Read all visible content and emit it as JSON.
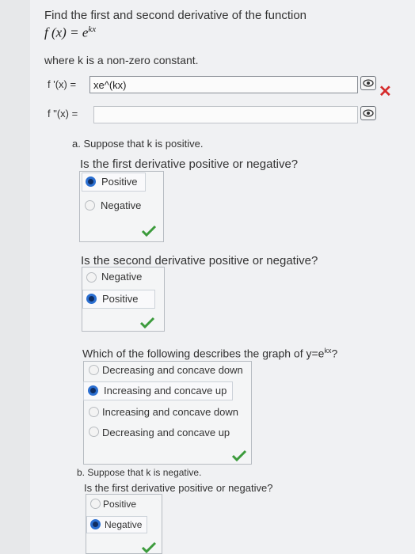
{
  "header": {
    "title": "Find the first and second derivative of the function",
    "function_lhs": "f (x) = e",
    "function_exp": "kx",
    "where": "where k is a non-zero constant."
  },
  "answers": {
    "first": {
      "label": "f '(x) =",
      "value": "xe^(kx)",
      "status": "incorrect"
    },
    "second": {
      "label": "f \"(x) =",
      "value": ""
    }
  },
  "part_a": {
    "intro": "a. Suppose that k is positive.",
    "q1": {
      "text": "Is the first derivative positive or negative?",
      "options": [
        "Positive",
        "Negative"
      ],
      "selected": "Positive"
    },
    "q2": {
      "text": "Is the second derivative positive or negative?",
      "options": [
        "Negative",
        "Positive"
      ],
      "selected": "Positive"
    },
    "q3": {
      "text_prefix": "Which of the following describes the graph of y=e",
      "text_exp": "kx",
      "text_suffix": "?",
      "options": [
        "Decreasing and concave down",
        "Increasing and concave up",
        "Increasing and concave down",
        "Decreasing and concave up"
      ],
      "selected": "Increasing and concave up"
    }
  },
  "part_b": {
    "intro": "b. Suppose that k is negative.",
    "q1": {
      "text": "Is the first derivative positive or negative?",
      "options": [
        "Positive",
        "Negative"
      ],
      "selected": "Negative"
    }
  },
  "colors": {
    "check": "#3c9b3c",
    "wrong": "#d52b2b",
    "radio_selected": "#2b6fd1"
  }
}
